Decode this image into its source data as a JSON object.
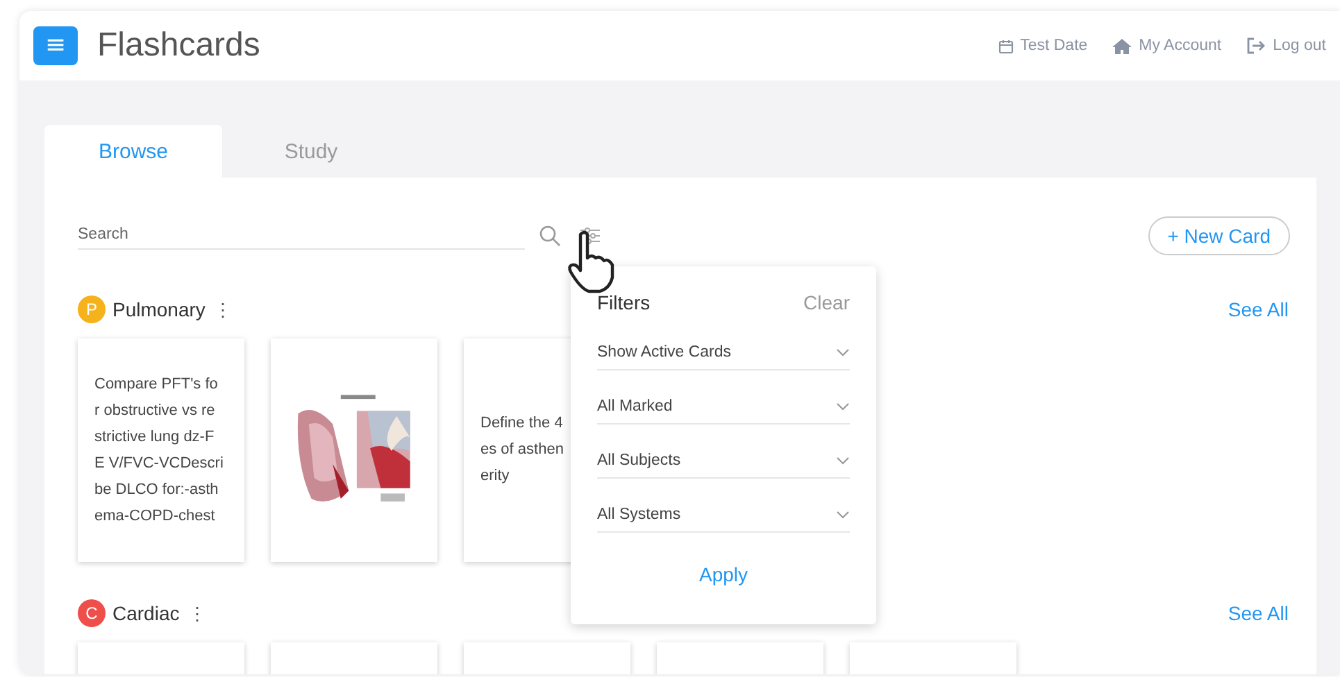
{
  "header": {
    "menu_button": "≡",
    "title": "Flashcards",
    "links": [
      {
        "kind": "calendar",
        "label": "Test Date"
      },
      {
        "kind": "home",
        "label": "My Account"
      },
      {
        "kind": "logout",
        "label": "Log out"
      }
    ]
  },
  "tabs": [
    {
      "label": "Browse",
      "selected": true
    },
    {
      "label": "Study",
      "selected": false
    }
  ],
  "search": {
    "placeholder": "Search"
  },
  "new_card_button": "+ New Card",
  "sections": [
    {
      "badge": "P",
      "color": "#f5b21b",
      "name": "Pulmonary",
      "menu": "⋮",
      "see_all": "See All",
      "cards": [
        {
          "kind": "text",
          "text": "Compare PFT's fo\nr obstructive vs re\nstrictive lung dz-F\nE V/FVC-VCDescri\nbe DLCO for:-asth\nema-COPD-chest"
        },
        {
          "kind": "picture"
        },
        {
          "kind": "text",
          "text": "Define the 4\nes of asthen\nerity"
        }
      ]
    },
    {
      "badge": "C",
      "color": "#ee4f4b",
      "name": "Cardiac",
      "menu": "⋮",
      "see_all": "See All",
      "cards": [
        {
          "kind": "blank"
        },
        {
          "kind": "blank"
        },
        {
          "kind": "blank"
        },
        {
          "kind": "blank"
        },
        {
          "kind": "blank"
        }
      ]
    }
  ],
  "filters": {
    "title": "Filters",
    "clear": "Clear",
    "selects": [
      "Show Active Cards",
      "All Marked",
      "All Subjects",
      "All Systems"
    ],
    "apply": "Apply"
  }
}
